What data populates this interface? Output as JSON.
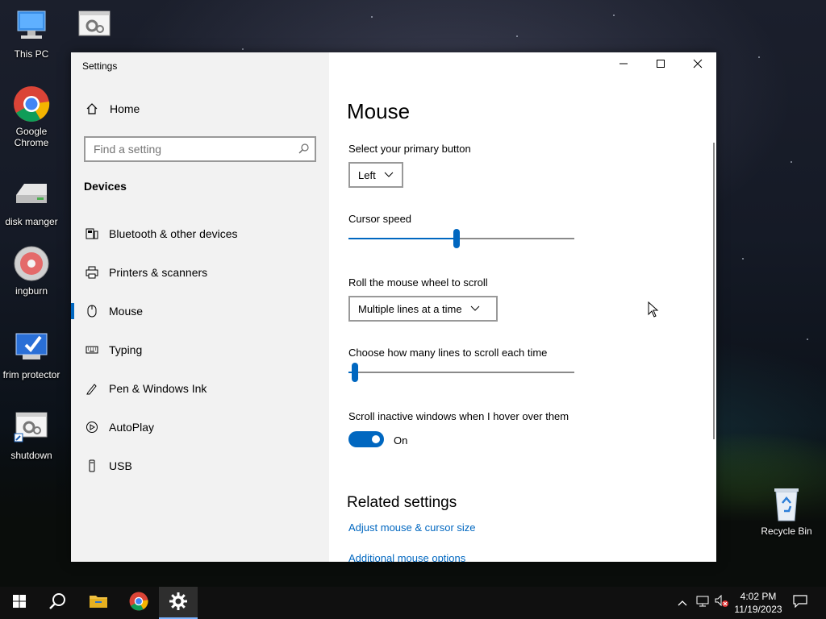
{
  "desktop": {
    "icons": [
      {
        "label": "This PC"
      },
      {
        "label": "Google Chrome"
      },
      {
        "label": "disk manger"
      },
      {
        "label": "ingburn"
      },
      {
        "label": "frim protector"
      },
      {
        "label": "shutdown"
      },
      {
        "label": "Recycle Bin"
      }
    ]
  },
  "window": {
    "title": "Settings",
    "controls": [
      "minimize-icon",
      "maximize-icon",
      "close-icon"
    ]
  },
  "sidebar": {
    "home_label": "Home",
    "search_placeholder": "Find a setting",
    "section": "Devices",
    "items": [
      {
        "label": "Bluetooth & other devices",
        "icon": "bluetooth-devices-icon"
      },
      {
        "label": "Printers & scanners",
        "icon": "printer-icon"
      },
      {
        "label": "Mouse",
        "icon": "mouse-icon",
        "active": true
      },
      {
        "label": "Typing",
        "icon": "keyboard-icon"
      },
      {
        "label": "Pen & Windows Ink",
        "icon": "pen-icon"
      },
      {
        "label": "AutoPlay",
        "icon": "autoplay-icon"
      },
      {
        "label": "USB",
        "icon": "usb-icon"
      }
    ]
  },
  "main": {
    "title": "Mouse",
    "primary_button": {
      "label": "Select your primary button",
      "value": "Left"
    },
    "cursor_speed": {
      "label": "Cursor speed",
      "level": 0.48
    },
    "scroll_mode": {
      "label": "Roll the mouse wheel to scroll",
      "value": "Multiple lines at a time"
    },
    "lines_to_scroll": {
      "label": "Choose how many lines to scroll each time",
      "level": 0.03
    },
    "scroll_inactive": {
      "label": "Scroll inactive windows when I hover over them",
      "state": "On"
    },
    "related": {
      "title": "Related settings",
      "links": [
        "Adjust mouse & cursor size",
        "Additional mouse options"
      ]
    }
  },
  "taskbar": {
    "time": "4:02 PM",
    "date": "11/19/2023"
  },
  "colors": {
    "accent": "#0067c0",
    "sidebar_bg": "#f2f2f2",
    "taskbar_bg": "#101010"
  }
}
